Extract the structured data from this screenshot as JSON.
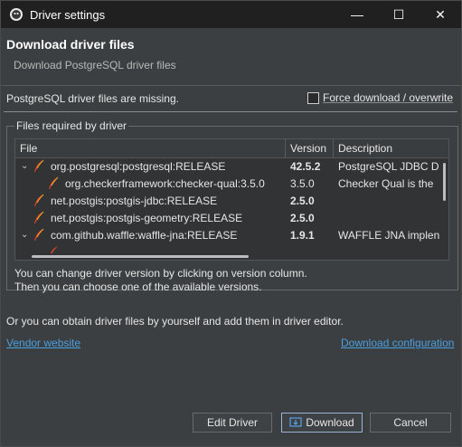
{
  "window": {
    "title": "Driver settings",
    "controls": {
      "minimize": "—",
      "maximize": "☐",
      "close": "✕"
    }
  },
  "header": {
    "title": "Download driver files",
    "subtitle": "Download PostgreSQL driver files"
  },
  "status": {
    "missing_text": "PostgreSQL driver files are missing.",
    "force_label": "Force download / overwrite",
    "force_checked": false
  },
  "files_group": {
    "legend": "Files required by driver",
    "columns": {
      "file": "File",
      "version": "Version",
      "description": "Description"
    },
    "rows": [
      {
        "file": "org.postgresql:postgresql:RELEASE",
        "version": "42.5.2",
        "description": "PostgreSQL JDBC Dr",
        "bold": true,
        "expandable": true
      },
      {
        "file": "org.checkerframework:checker-qual:3.5.0",
        "version": "3.5.0",
        "description": "Checker Qual is the",
        "bold": false,
        "expandable": false
      },
      {
        "file": "net.postgis:postgis-jdbc:RELEASE",
        "version": "2.5.0",
        "description": "",
        "bold": true,
        "expandable": false
      },
      {
        "file": "net.postgis:postgis-geometry:RELEASE",
        "version": "2.5.0",
        "description": "",
        "bold": true,
        "expandable": false
      },
      {
        "file": "com.github.waffle:waffle-jna:RELEASE",
        "version": "1.9.1",
        "description": "WAFFLE JNA implen",
        "bold": true,
        "expandable": true
      }
    ],
    "hint_line1": "You can change driver version by clicking on version column.",
    "hint_line2": "Then you can choose one of the available versions."
  },
  "obtain_text": "Or you can obtain driver files by yourself and add them in driver editor.",
  "links": {
    "vendor": "Vendor website",
    "download_config": "Download configuration"
  },
  "buttons": {
    "edit_driver": "Edit Driver",
    "download": "Download",
    "cancel": "Cancel"
  },
  "colors": {
    "accent_link": "#4a9fe0",
    "background": "#3c3f41",
    "titlebar": "#202020"
  },
  "icons": {
    "app": "dbeaver-beaver-icon",
    "artifact": "maven-feather-icon",
    "download": "download-icon"
  }
}
